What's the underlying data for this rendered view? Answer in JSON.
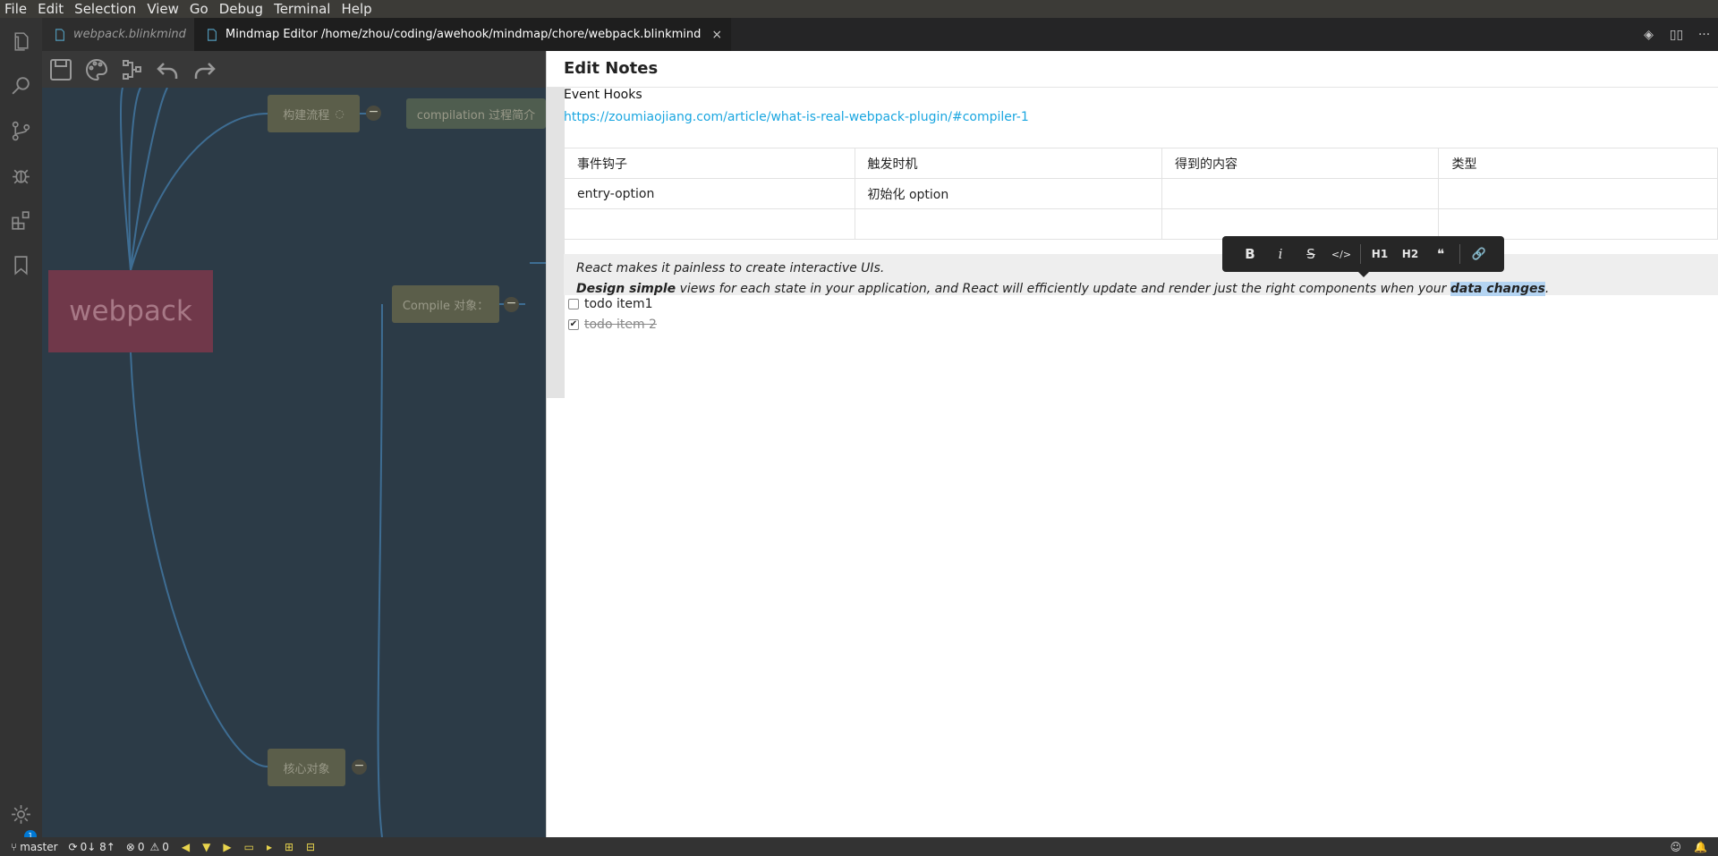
{
  "menu": [
    "File",
    "Edit",
    "Selection",
    "View",
    "Go",
    "Debug",
    "Terminal",
    "Help"
  ],
  "tabs": [
    {
      "label": "webpack.blinkmind"
    },
    {
      "label": "Mindmap Editor /home/zhou/coding/awehook/mindmap/chore/webpack.blinkmind",
      "close": "×"
    }
  ],
  "tab_actions": [
    "◈",
    "▯▯",
    "···"
  ],
  "mindmap": {
    "root": "webpack",
    "nodes": [
      "构建流程",
      "compilation 过程简介",
      "Compile 对象：",
      "核心对象"
    ],
    "collapse_glyph": "−"
  },
  "notes": {
    "title": "Edit Notes",
    "heading": "Event Hooks",
    "link": "https://zoumiaojiang.com/article/what-is-real-webpack-plugin/#compiler-1",
    "table": {
      "headers": [
        "事件钩子",
        "触发时机",
        "得到的内容",
        "类型"
      ],
      "rows": [
        [
          "entry-option",
          "初始化 option",
          "",
          ""
        ],
        [
          "",
          "",
          "",
          ""
        ]
      ]
    },
    "quote": {
      "line1": "React makes it painless to create interactive UIs.",
      "line2_bold": "Design simple",
      "line2_mid": " views for each state in your application, and React will efficiently update and render just the right components when your ",
      "line2_selected": "data changes",
      "line2_end": "."
    },
    "todos": [
      {
        "label": "todo item1",
        "checked": false
      },
      {
        "label": "todo item 2",
        "checked": true
      }
    ],
    "format_toolbar": [
      "B",
      "i",
      "S",
      "</>",
      "H1",
      "H2",
      "❝",
      "🔗"
    ]
  },
  "status": {
    "branch": "master",
    "sync": "0↓ 8↑",
    "errors": "0",
    "warnings": "0",
    "badge": "1"
  }
}
